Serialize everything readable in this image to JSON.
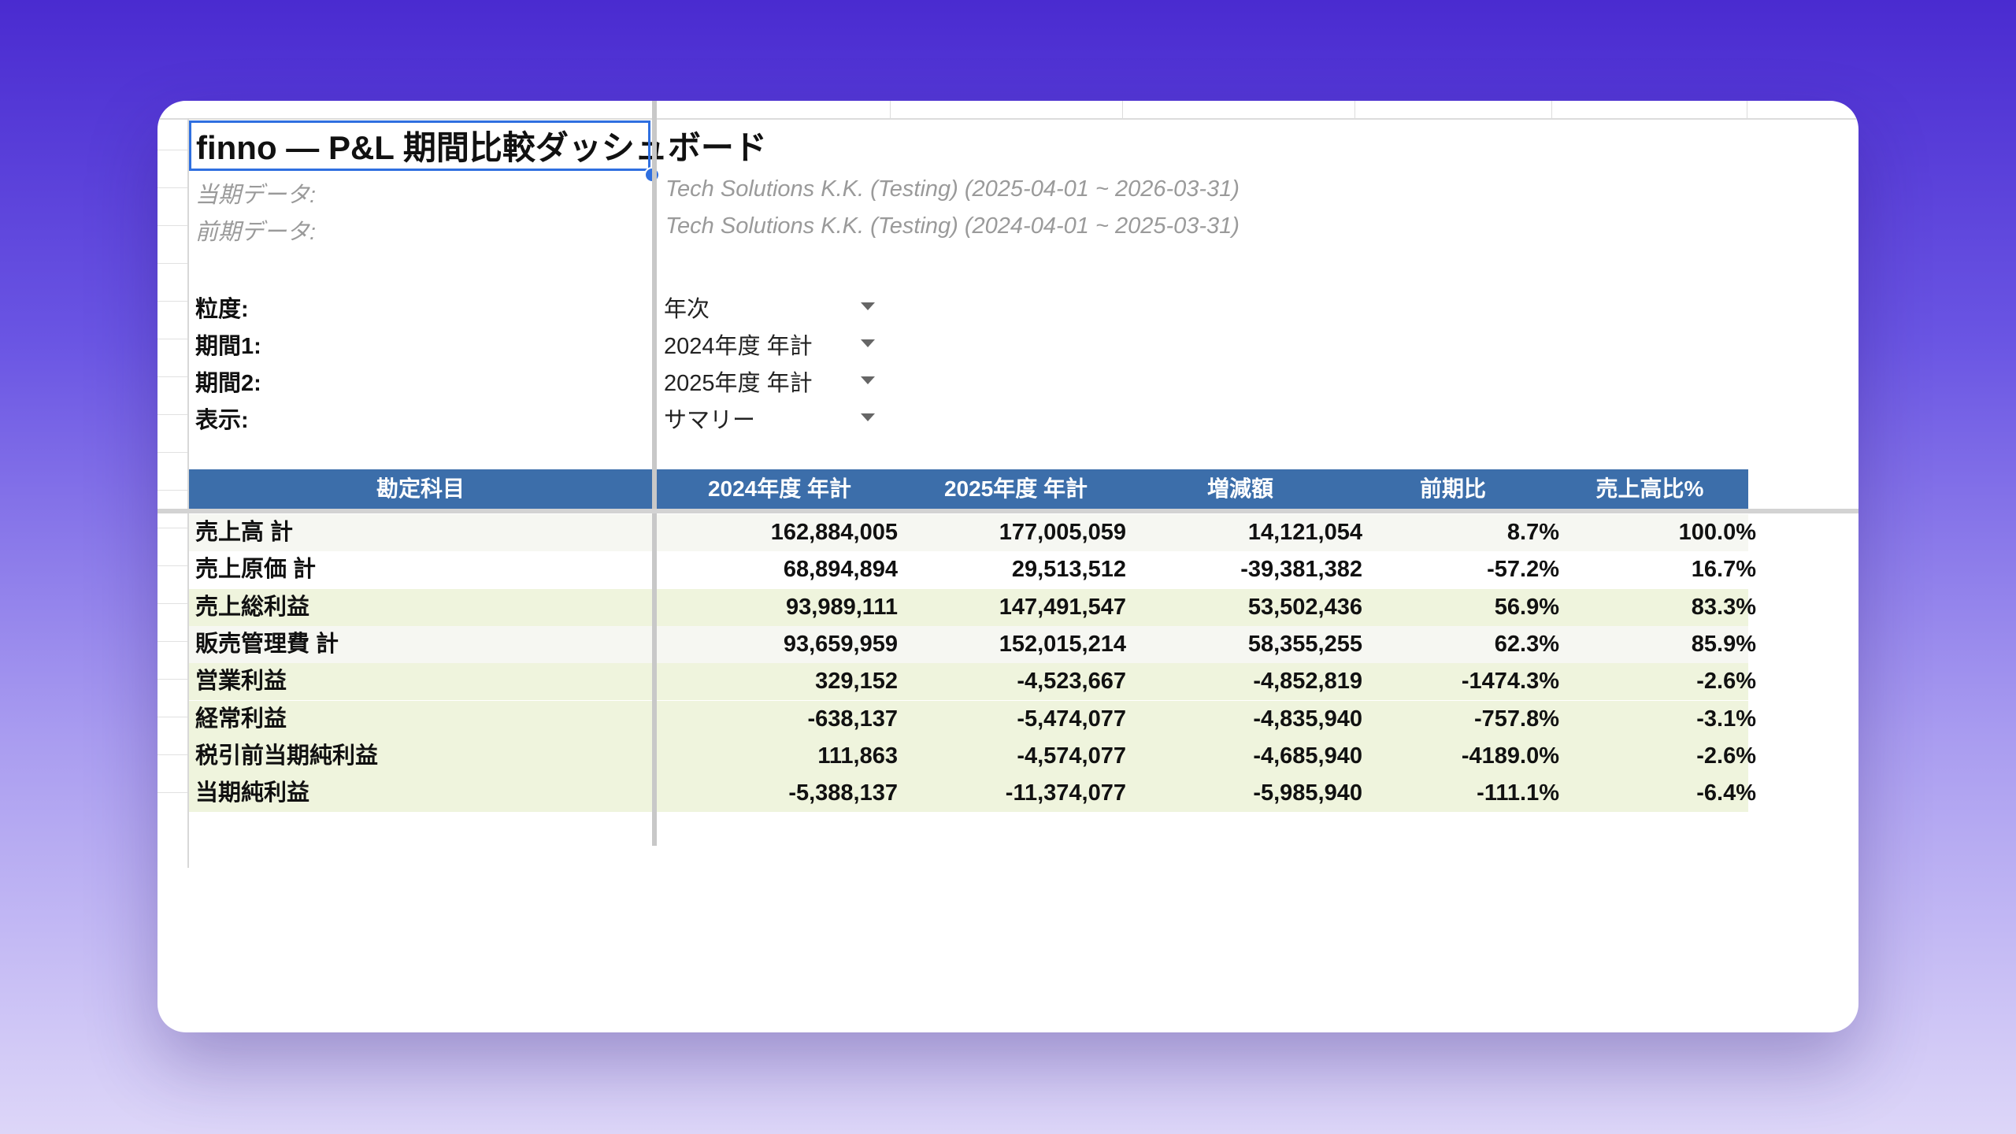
{
  "sheet": {
    "title": "finno — P&L 期間比較ダッシュボード",
    "current_label": "当期データ:",
    "current_value": "Tech Solutions K.K. (Testing) (2025-04-01 ~ 2026-03-31)",
    "prior_label": "前期データ:",
    "prior_value": "Tech Solutions K.K. (Testing) (2024-04-01 ~ 2025-03-31)"
  },
  "controls": [
    {
      "label": "粒度:",
      "value": "年次"
    },
    {
      "label": "期間1:",
      "value": "2024年度 年計"
    },
    {
      "label": "期間2:",
      "value": "2025年度 年計"
    },
    {
      "label": "表示:",
      "value": "サマリー"
    }
  ],
  "table": {
    "headers": [
      "勘定科目",
      "2024年度 年計",
      "2025年度 年計",
      "増減額",
      "前期比",
      "売上高比%"
    ],
    "rows": [
      {
        "cells": [
          "売上高 計",
          "162,884,005",
          "177,005,059",
          "14,121,054",
          "8.7%",
          "100.0%"
        ],
        "bg": "#f6f7f2"
      },
      {
        "cells": [
          "売上原価 計",
          "68,894,894",
          "29,513,512",
          "-39,381,382",
          "-57.2%",
          "16.7%"
        ],
        "bg": "#ffffff"
      },
      {
        "cells": [
          "売上総利益",
          "93,989,111",
          "147,491,547",
          "53,502,436",
          "56.9%",
          "83.3%"
        ],
        "bg": "#eff4dd"
      },
      {
        "cells": [
          "販売管理費 計",
          "93,659,959",
          "152,015,214",
          "58,355,255",
          "62.3%",
          "85.9%"
        ],
        "bg": "#f6f7f2"
      },
      {
        "cells": [
          "営業利益",
          "329,152",
          "-4,523,667",
          "-4,852,819",
          "-1474.3%",
          "-2.6%"
        ],
        "bg": "#eff4dd"
      },
      {
        "cells": [
          "経常利益",
          "-638,137",
          "-5,474,077",
          "-4,835,940",
          "-757.8%",
          "-3.1%"
        ],
        "bg": "#eff4dd"
      },
      {
        "cells": [
          "税引前当期純利益",
          "111,863",
          "-4,574,077",
          "-4,685,940",
          "-4189.0%",
          "-2.6%"
        ],
        "bg": "#eff4dd"
      },
      {
        "cells": [
          "当期純利益",
          "-5,388,137",
          "-11,374,077",
          "-5,985,940",
          "-111.1%",
          "-6.4%"
        ],
        "bg": "#eff4dd"
      }
    ]
  },
  "colors": {
    "header_bg": "#3c6eaa",
    "selection": "#2f6fe0"
  }
}
